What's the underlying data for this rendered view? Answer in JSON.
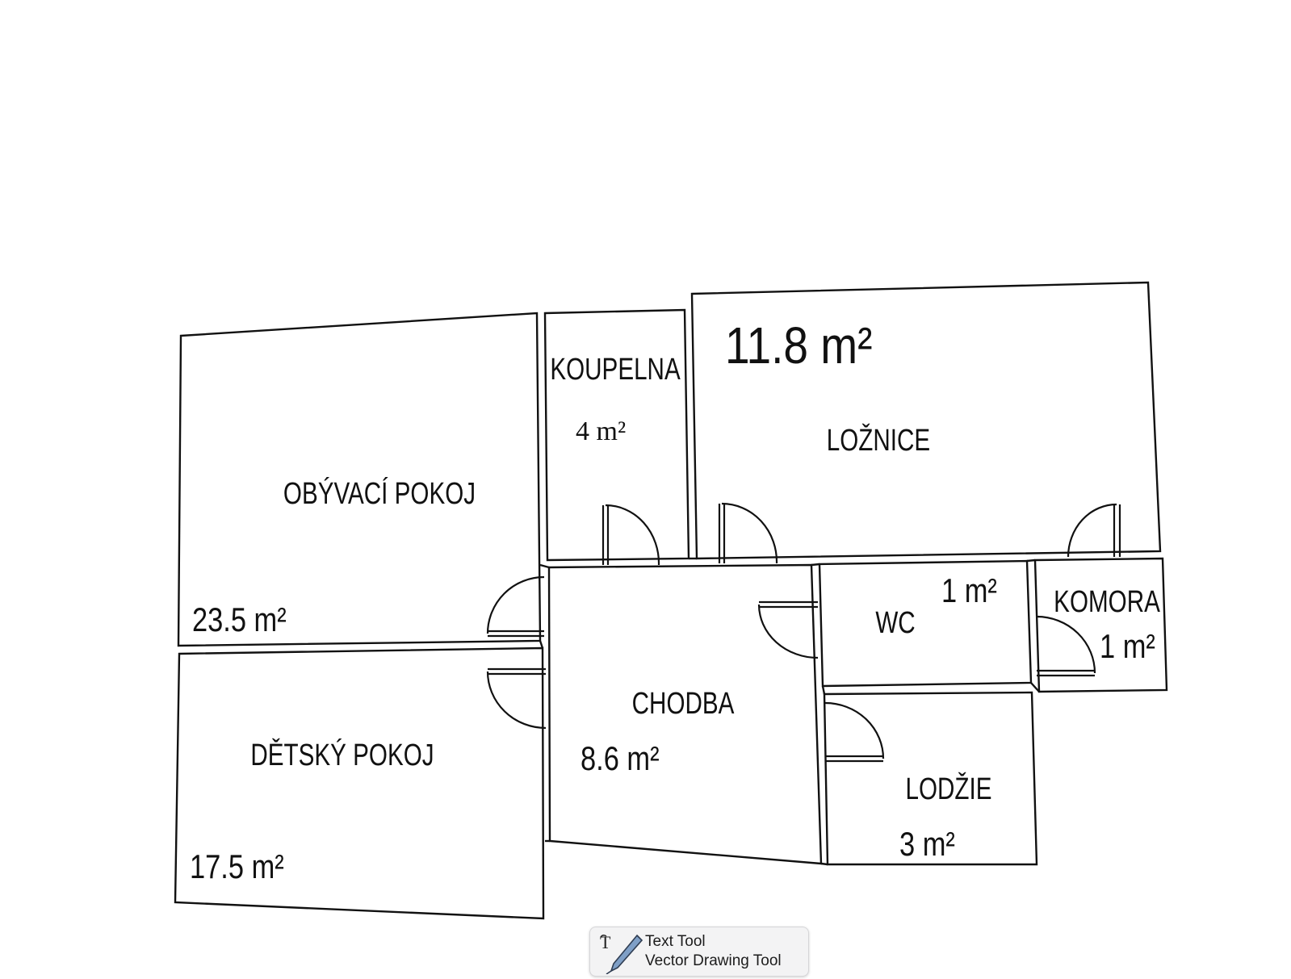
{
  "floor_plan": {
    "rooms": [
      {
        "id": "obyvaci",
        "name": "OBÝVACÍ POKOJ",
        "area": "23.5 m²"
      },
      {
        "id": "koupelna",
        "name": "KOUPELNA",
        "area": "4 m²"
      },
      {
        "id": "loznice",
        "name": "LOŽNICE",
        "area": "11.8 m²"
      },
      {
        "id": "chodba",
        "name": "CHODBA",
        "area": "8.6 m²"
      },
      {
        "id": "wc",
        "name": "WC",
        "area": "1 m²"
      },
      {
        "id": "komora",
        "name": "KOMORA",
        "area": "1 m²"
      },
      {
        "id": "detsky",
        "name": "DĚTSKÝ POKOJ",
        "area": "17.5 m²"
      },
      {
        "id": "lodzie",
        "name": "LODŽIE",
        "area": "3 m²"
      }
    ]
  },
  "tool_popup": {
    "items": [
      {
        "label": "Text Tool"
      },
      {
        "label": "Vector Drawing Tool"
      }
    ]
  }
}
